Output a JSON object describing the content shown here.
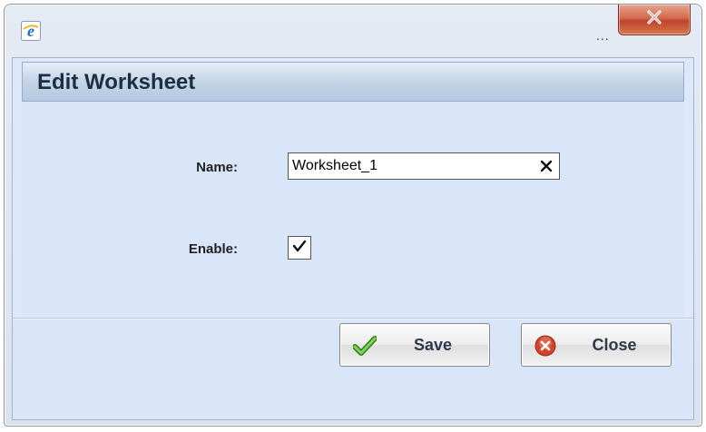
{
  "window": {
    "title_icon": "ie-icon",
    "ellipsis": "...",
    "close_icon": "close-icon"
  },
  "dialog": {
    "title": "Edit Worksheet",
    "fields": {
      "name_label": "Name:",
      "name_value": "Worksheet_1",
      "clear_icon": "clear-x-icon",
      "enable_label": "Enable:",
      "enable_checked": true
    },
    "buttons": {
      "save_label": "Save",
      "save_icon": "checkmark-icon",
      "close_label": "Close",
      "close_icon": "cancel-icon"
    }
  },
  "colors": {
    "panel_bg": "#d9e6f9",
    "header_title": "#1c2e44",
    "close_red": "#c0432a",
    "check_green": "#3c9a23",
    "cancel_red": "#d2452b"
  }
}
